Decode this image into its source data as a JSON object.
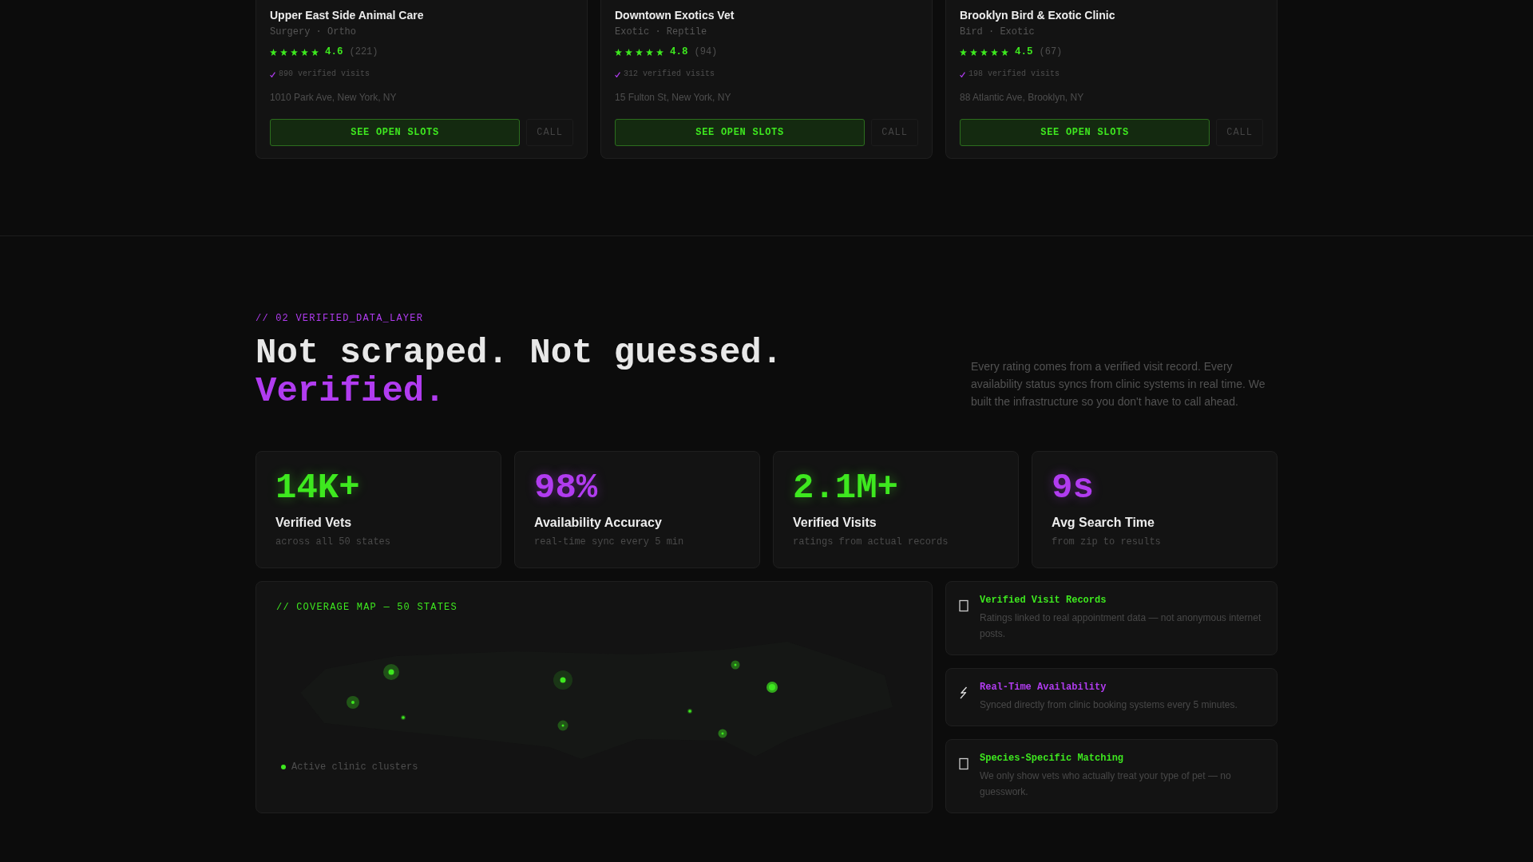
{
  "clinics": [
    {
      "name": "Upper East Side Animal Care",
      "specialties": "Surgery · Ortho",
      "stars": 5,
      "rating": "4.6",
      "reviews": "(221)",
      "verified_visits": "890 verified visits",
      "address": "1010 Park Ave, New York, NY",
      "primary_action": "SEE OPEN SLOTS",
      "secondary_action": "CALL"
    },
    {
      "name": "Downtown Exotics Vet",
      "specialties": "Exotic · Reptile",
      "stars": 5,
      "rating": "4.8",
      "reviews": "(94)",
      "verified_visits": "312 verified visits",
      "address": "15 Fulton St, New York, NY",
      "primary_action": "SEE OPEN SLOTS",
      "secondary_action": "CALL"
    },
    {
      "name": "Brooklyn Bird & Exotic Clinic",
      "specialties": "Bird · Exotic",
      "stars": 5,
      "rating": "4.5",
      "reviews": "(67)",
      "verified_visits": "198 verified visits",
      "address": "88 Atlantic Ave, Brooklyn, NY",
      "primary_action": "SEE OPEN SLOTS",
      "secondary_action": "CALL"
    }
  ],
  "data_section": {
    "eyebrow": "// 02 VERIFIED_DATA_LAYER",
    "heading": "Not scraped. Not guessed.",
    "heading_highlight": "Verified.",
    "description": "Every rating comes from a verified visit record. Every availability status syncs from clinic systems in real time. We built the infrastructure so you don't have to call ahead."
  },
  "stats": [
    {
      "value": "14K+",
      "color": "#3ee81f",
      "label": "Verified Vets",
      "caption": "across all 50 states"
    },
    {
      "value": "98%",
      "color": "#b13cf0",
      "label": "Availability Accuracy",
      "caption": "real-time sync every 5 min"
    },
    {
      "value": "2.1M+",
      "color": "#3ee81f",
      "label": "Verified Visits",
      "caption": "ratings from actual records"
    },
    {
      "value": "9s",
      "color": "#b13cf0",
      "label": "Avg Search Time",
      "caption": "from zip to results"
    }
  ],
  "coverage_map": {
    "title": "// COVERAGE MAP — 50 STATES",
    "legend": "Active clinic clusters"
  },
  "features": [
    {
      "title": "Verified Visit Records",
      "color": "#3ee81f",
      "description": "Ratings linked to real appointment data — not anonymous internet posts."
    },
    {
      "title": "Real-Time Availability",
      "color": "#b13cf0",
      "description": "Synced directly from clinic booking systems every 5 minutes."
    },
    {
      "title": "Species-Specific Matching",
      "color": "#3ee81f",
      "description": "We only show vets who actually treat your type of pet — no guesswork."
    }
  ]
}
